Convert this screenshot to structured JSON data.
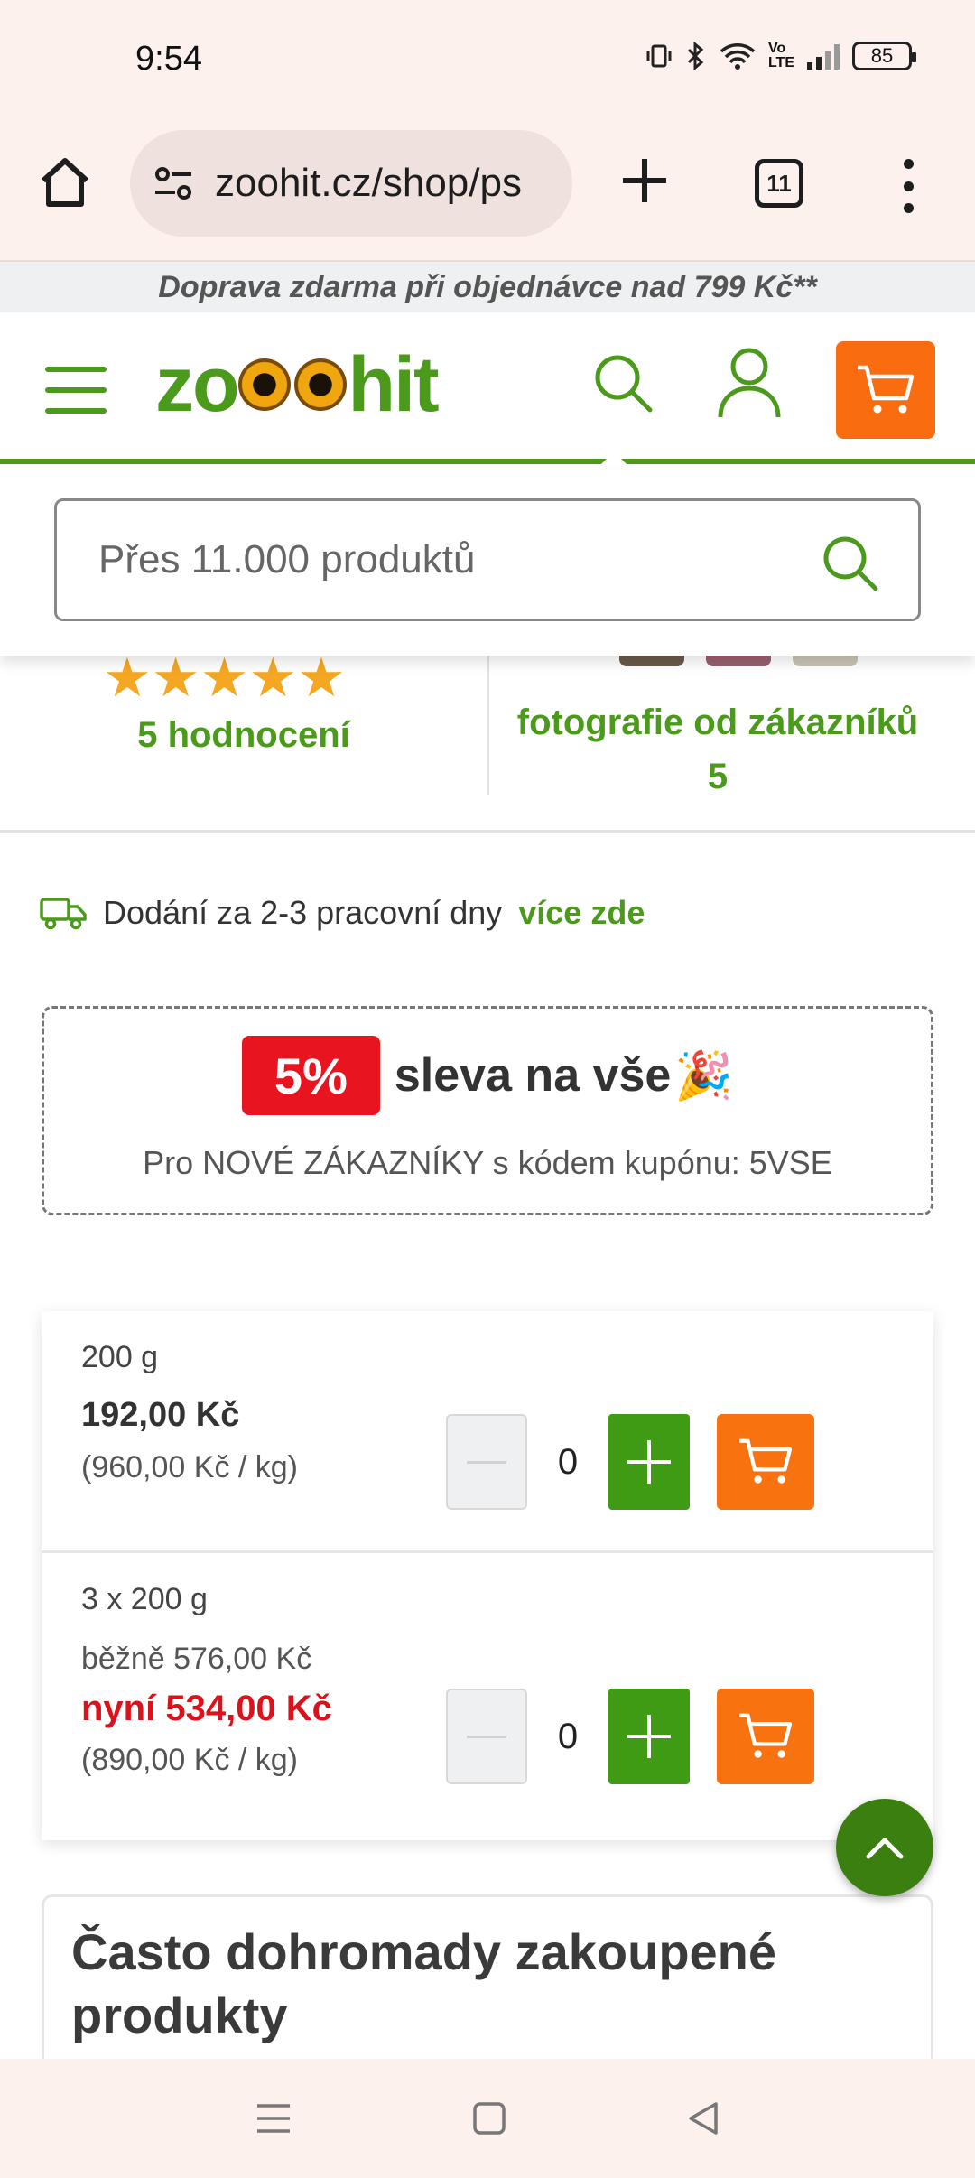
{
  "status_bar": {
    "time": "9:54",
    "battery": "85"
  },
  "browser": {
    "url": "zoohit.cz/shop/ps",
    "tab_count": "11"
  },
  "shipping_banner": "Doprava zdarma při objednávce nad 799 Kč**",
  "header": {
    "logo_prefix": "zo",
    "logo_suffix": "hit",
    "brand_color": "#4b9a1c",
    "cart_color": "#f96c0f"
  },
  "search": {
    "placeholder": "Přes 11.000 produktů"
  },
  "rating": {
    "stars": "★★★★★",
    "count_label": "5 hodnocení",
    "photos_label": "fotografie od zákazníků",
    "photos_count": "5"
  },
  "delivery": {
    "text": "Dodání za 2-3 pracovní dny",
    "link": "více zde"
  },
  "coupon": {
    "badge": "5%",
    "title": "sleva na vše",
    "emoji": "🎉",
    "subtitle": "Pro NOVÉ ZÁKAZNÍKY s kódem kupónu: 5VSE"
  },
  "variants": [
    {
      "name": "200 g",
      "price": "192,00 Kč",
      "unit_price": "(960,00 Kč / kg)",
      "qty": "0"
    },
    {
      "name": "3 x 200 g",
      "regular_price": "běžně 576,00 Kč",
      "now_price": "nyní 534,00 Kč",
      "unit_price": "(890,00 Kč / kg)",
      "qty": "0"
    }
  ],
  "often_bought": {
    "title": "Často dohromady zakoupené produkty"
  }
}
